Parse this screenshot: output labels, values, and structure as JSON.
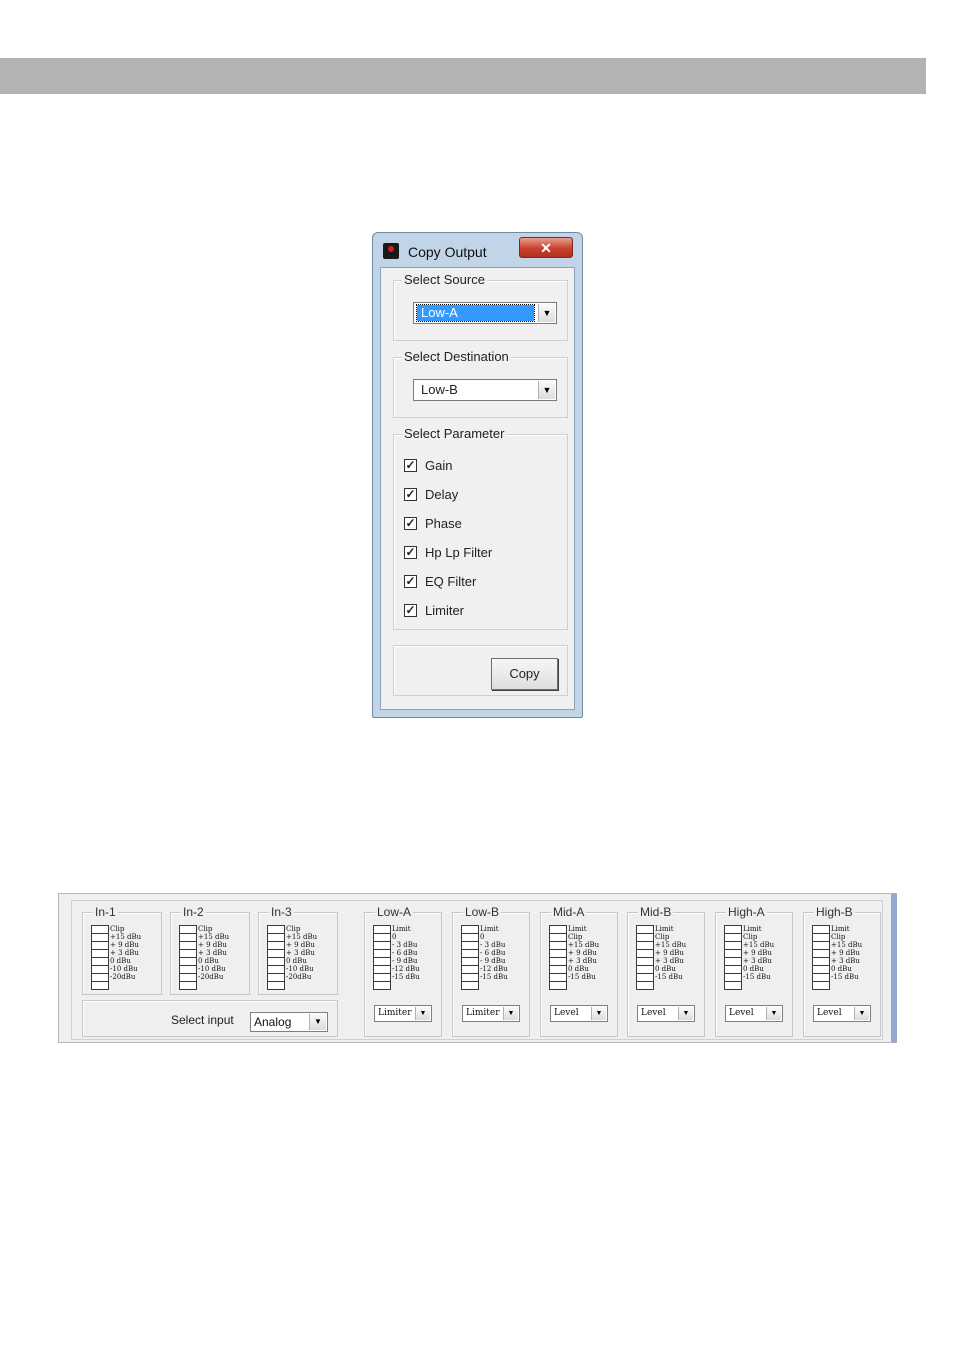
{
  "dialog": {
    "title": "Copy Output",
    "close_glyph": "✕",
    "source": {
      "label": "Select Source",
      "value": "Low-A"
    },
    "destination": {
      "label": "Select Destination",
      "value": "Low-B"
    },
    "parameters": {
      "label": "Select Parameter",
      "items": [
        {
          "label": "Gain",
          "checked": true
        },
        {
          "label": "Delay",
          "checked": true
        },
        {
          "label": "Phase",
          "checked": true
        },
        {
          "label": "Hp Lp Filter",
          "checked": true
        },
        {
          "label": "EQ Filter",
          "checked": true
        },
        {
          "label": "Limiter",
          "checked": true
        }
      ]
    },
    "copy_label": "Copy"
  },
  "meters_panel": {
    "select_input_label": "Select input",
    "select_input_value": "Analog",
    "inputs": [
      {
        "name": "In-1",
        "scale": [
          "Clip",
          "+15 dBu",
          "+ 9 dBu",
          "+ 3 dBu",
          "0 dBu",
          "-10 dBu",
          "-20dBu"
        ]
      },
      {
        "name": "In-2",
        "scale": [
          "Clip",
          "+15 dBu",
          "+ 9 dBu",
          "+ 3 dBu",
          "0 dBu",
          "-10 dBu",
          "-20dBu"
        ]
      },
      {
        "name": "In-3",
        "scale": [
          "Clip",
          "+15 dBu",
          "+ 9 dBu",
          "+ 3 dBu",
          "0 dBu",
          "-10 dBu",
          "-20dBu"
        ]
      }
    ],
    "outputs": [
      {
        "name": "Low-A",
        "scale": [
          "Limit",
          "0",
          "- 3 dBu",
          "- 6 dBu",
          "- 9 dBu",
          "-12 dBu",
          "-15 dBu"
        ],
        "mode": "Limiter"
      },
      {
        "name": "Low-B",
        "scale": [
          "Limit",
          "0",
          "- 3 dBu",
          "- 6 dBu",
          "- 9 dBu",
          "-12 dBu",
          "-15 dBu"
        ],
        "mode": "Limiter"
      },
      {
        "name": "Mid-A",
        "scale": [
          "Limit",
          "Clip",
          "+15 dBu",
          "+ 9 dBu",
          "+ 3 dBu",
          "0 dBu",
          "-15 dBu"
        ],
        "mode": "Level"
      },
      {
        "name": "Mid-B",
        "scale": [
          "Limit",
          "Clip",
          "+15 dBu",
          "+ 9 dBu",
          "+ 3 dBu",
          "0 dBu",
          "-15 dBu"
        ],
        "mode": "Level"
      },
      {
        "name": "High-A",
        "scale": [
          "Limit",
          "Clip",
          "+15 dBu",
          "+ 9 dBu",
          "+ 3 dBu",
          "0 dBu",
          "-15 dBu"
        ],
        "mode": "Level"
      },
      {
        "name": "High-B",
        "scale": [
          "Limit",
          "Clip",
          "+15 dBu",
          "+ 9 dBu",
          "+ 3 dBu",
          "0 dBu",
          "-15 dBu"
        ],
        "mode": "Level"
      }
    ]
  }
}
